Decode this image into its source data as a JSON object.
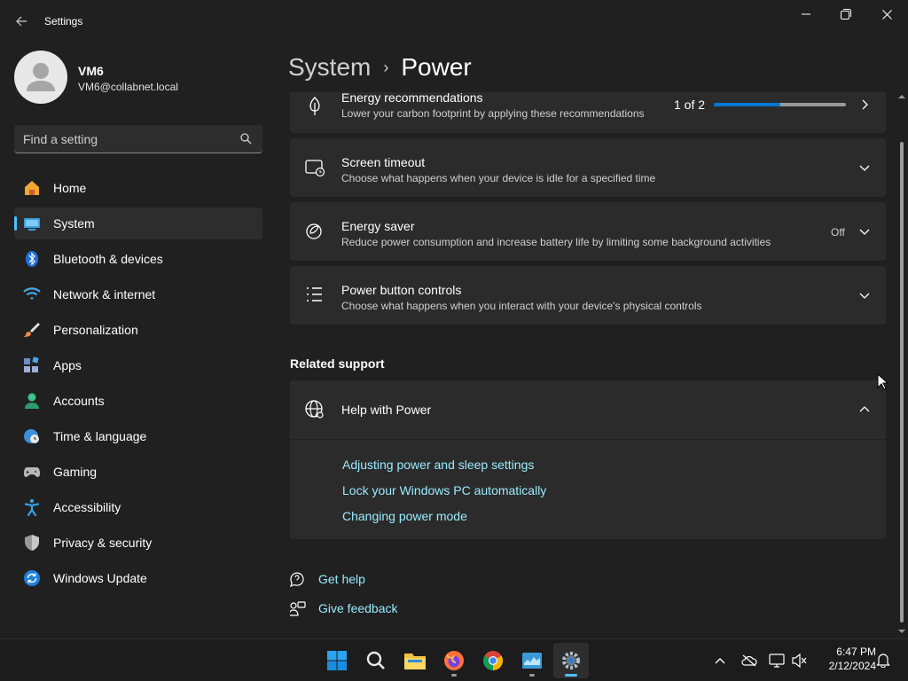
{
  "window": {
    "title": "Settings",
    "controls": [
      "minimize",
      "maximize",
      "close"
    ]
  },
  "profile": {
    "name": "VM6",
    "email": "VM6@collabnet.local"
  },
  "search": {
    "placeholder": "Find a setting",
    "value": ""
  },
  "sidebar": {
    "items": [
      {
        "label": "Home",
        "icon": "home-icon"
      },
      {
        "label": "System",
        "icon": "system-icon",
        "selected": true
      },
      {
        "label": "Bluetooth & devices",
        "icon": "bluetooth-icon"
      },
      {
        "label": "Network & internet",
        "icon": "wifi-icon"
      },
      {
        "label": "Personalization",
        "icon": "brush-icon"
      },
      {
        "label": "Apps",
        "icon": "apps-icon"
      },
      {
        "label": "Accounts",
        "icon": "accounts-icon"
      },
      {
        "label": "Time & language",
        "icon": "globe-clock-icon"
      },
      {
        "label": "Gaming",
        "icon": "gamepad-icon"
      },
      {
        "label": "Accessibility",
        "icon": "accessibility-icon"
      },
      {
        "label": "Privacy & security",
        "icon": "shield-icon"
      },
      {
        "label": "Windows Update",
        "icon": "update-icon"
      }
    ]
  },
  "header": {
    "parent": "System",
    "separator": "›",
    "current": "Power"
  },
  "cards": {
    "energy_recommendations": {
      "title": "Energy recommendations",
      "description": "Lower your carbon footprint by applying these recommendations",
      "progress_text": "1 of 2",
      "progress_fraction": 0.5
    },
    "screen_timeout": {
      "title": "Screen timeout",
      "description": "Choose what happens when your device is idle for a specified time"
    },
    "energy_saver": {
      "title": "Energy saver",
      "description": "Reduce power consumption and increase battery life by limiting some background activities",
      "status": "Off"
    },
    "power_button": {
      "title": "Power button controls",
      "description": "Choose what happens when you interact with your device's physical controls"
    }
  },
  "related": {
    "heading": "Related support",
    "help_title": "Help with Power",
    "links": [
      "Adjusting power and sleep settings",
      "Lock your Windows PC automatically",
      "Changing power mode"
    ]
  },
  "footer_links": {
    "get_help": "Get help",
    "give_feedback": "Give feedback"
  },
  "taskbar": {
    "apps": [
      "start-icon",
      "search-icon",
      "file-explorer-icon",
      "firefox-icon",
      "chrome-icon",
      "task-manager-icon",
      "settings-icon"
    ],
    "time": "6:47 PM",
    "date": "2/12/2024"
  },
  "colors": {
    "accent": "#4cc2ff",
    "link": "#99ebff",
    "background": "#202020",
    "card": "#2b2b2b",
    "progress": "#0078d4"
  }
}
